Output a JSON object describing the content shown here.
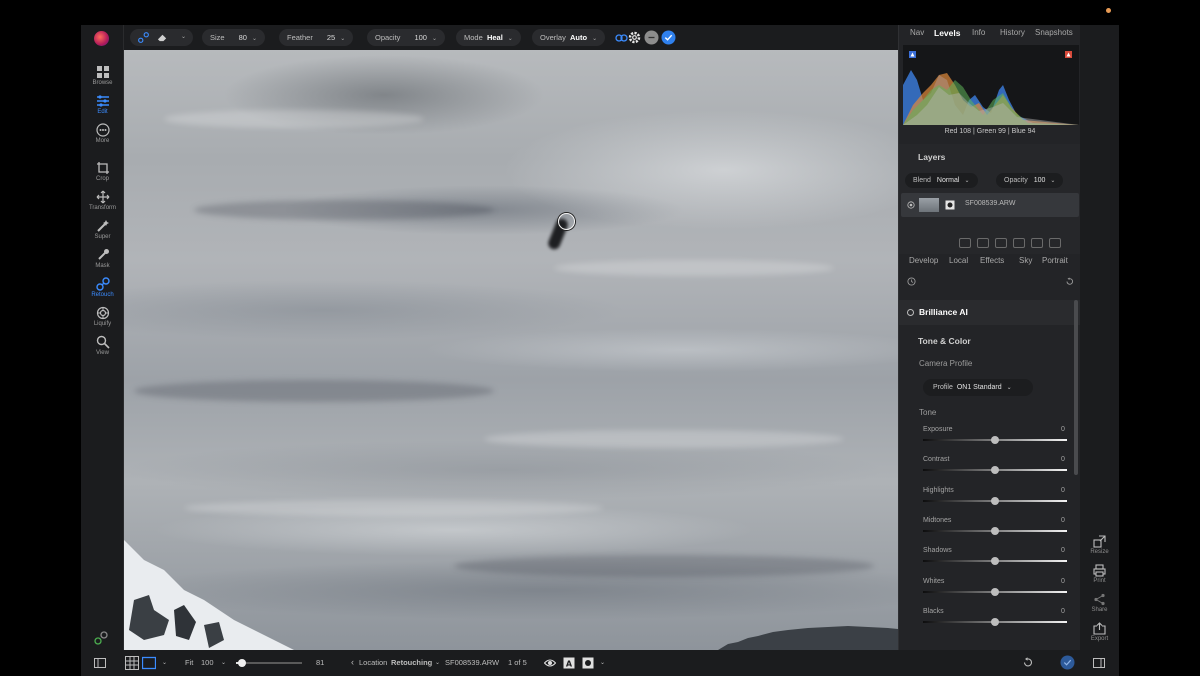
{
  "toolbar": {
    "tools": [
      {
        "label": "Browse",
        "icon": "grid-icon"
      },
      {
        "label": "Edit",
        "icon": "sliders-icon",
        "active": true
      },
      {
        "label": "More",
        "icon": "more-icon"
      },
      {
        "label": "Crop",
        "icon": "crop-icon"
      },
      {
        "label": "Transform",
        "icon": "transform-icon"
      },
      {
        "label": "Super",
        "icon": "super-brush-icon"
      },
      {
        "label": "Mask",
        "icon": "mask-brush-icon"
      },
      {
        "label": "Retouch",
        "icon": "retouch-icon",
        "active": true
      },
      {
        "label": "Liquify",
        "icon": "liquify-icon"
      },
      {
        "label": "View",
        "icon": "zoom-icon"
      }
    ]
  },
  "options": {
    "size_label": "Size",
    "size_value": "80",
    "feather_label": "Feather",
    "feather_value": "25",
    "opacity_label": "Opacity",
    "opacity_value": "100",
    "mode_label": "Mode",
    "mode_value": "Heal",
    "overlay_label": "Overlay",
    "overlay_value": "Auto"
  },
  "bottom": {
    "fit_label": "Fit",
    "zoom_value": "100",
    "zoom_slider_value": "81",
    "zoom_fraction": 0.09,
    "location_label": "Location",
    "location_value": "Retouching",
    "filename": "SF008539.ARW",
    "page_count": "1 of 5"
  },
  "right_panel": {
    "tabs": [
      "Nav",
      "Levels",
      "Info",
      "History",
      "Snapshots"
    ],
    "active_tab": "Levels",
    "readout": "Red 108 | Green  99  | Blue  94",
    "layers_title": "Layers",
    "blend_label": "Blend",
    "blend_value": "Normal",
    "opacity_label": "Opacity",
    "opacity_value": "100",
    "layer_name": "SF008539.ARW",
    "module_tabs": [
      "Develop",
      "Local",
      "Effects",
      "Sky",
      "Portrait"
    ],
    "brilliance": "Brilliance AI",
    "tone_color": "Tone & Color",
    "camera_profile": "Camera Profile",
    "profile_label": "Profile",
    "profile_value": "ON1 Standard",
    "tone": "Tone",
    "sliders": [
      {
        "label": "Exposure",
        "value": "0",
        "pos": 0.5
      },
      {
        "label": "Contrast",
        "value": "0",
        "pos": 0.5
      },
      {
        "label": "Highlights",
        "value": "0",
        "pos": 0.5
      },
      {
        "label": "Midtones",
        "value": "0",
        "pos": 0.5
      },
      {
        "label": "Shadows",
        "value": "0",
        "pos": 0.5
      },
      {
        "label": "Whites",
        "value": "0",
        "pos": 0.5
      },
      {
        "label": "Blacks",
        "value": "0",
        "pos": 0.5
      }
    ]
  },
  "strip": [
    {
      "label": "Resize",
      "icon": "resize-icon"
    },
    {
      "label": "Print",
      "icon": "print-icon"
    },
    {
      "label": "Share",
      "icon": "share-icon"
    },
    {
      "label": "Export",
      "icon": "export-icon"
    }
  ],
  "colors": {
    "accent": "#3b8cff",
    "bg": "#1e1f21",
    "panel": "#232427"
  }
}
